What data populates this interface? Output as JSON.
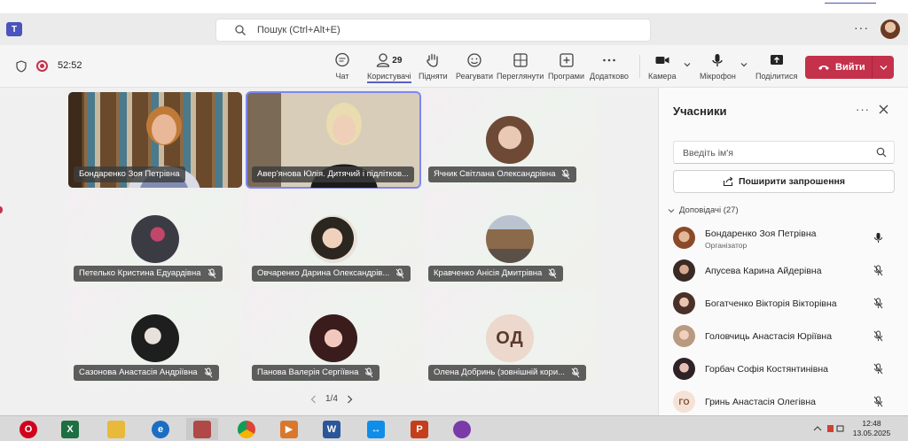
{
  "app": {
    "brand_color": "#4b53bc",
    "search_placeholder": "Пошук (Ctrl+Alt+E)",
    "more_label": "···"
  },
  "top_strip": {
    "text": ""
  },
  "meeting": {
    "timer": "52:52",
    "toolbar": {
      "chat": "Чат",
      "people": "Користувачі",
      "people_count": "29",
      "raise": "Підняти",
      "react": "Реагувати",
      "view": "Переглянути",
      "apps": "Програми",
      "more": "Додатково",
      "camera": "Камера",
      "mic": "Мікрофон",
      "share": "Поділитися",
      "leave": "Вийти"
    },
    "leave_color": "#c4314b"
  },
  "stage": {
    "tiles": [
      {
        "name": "Бондаренко Зоя Петрівна",
        "type": "video1",
        "muted": false
      },
      {
        "name": "Авер'янова Юлія. Дитячий і підлітков...",
        "type": "video2",
        "muted": false,
        "selected": true
      },
      {
        "name": "Ячник Світлана Олександрівна",
        "type": "avatar",
        "muted": true
      },
      {
        "name": "Петелько Кристина Едуардівна",
        "type": "avatar",
        "muted": true
      },
      {
        "name": "Овчаренко Дарина Олександрів...",
        "type": "avatar",
        "muted": true
      },
      {
        "name": "Кравченко Анісія Дмитрівна",
        "type": "avatar",
        "muted": true
      },
      {
        "name": "Сазонова Анастасія Андріївна",
        "type": "avatar",
        "muted": true
      },
      {
        "name": "Панова Валерія Сергіївна",
        "type": "avatar",
        "muted": true
      },
      {
        "name": "Олена Добринь (зовнішній кори...",
        "type": "initials",
        "initials": "ОД",
        "muted": true
      }
    ],
    "pager": "1/4"
  },
  "panel": {
    "title": "Учасники",
    "search_placeholder": "Введіть ім'я",
    "share_invite": "Поширити запрошення",
    "section": "Доповідачі (27)",
    "people": [
      {
        "name": "Бондаренко Зоя Петрівна",
        "role": "Організатор",
        "muted": false
      },
      {
        "name": "Апусева Карина Айдерівна",
        "muted": true
      },
      {
        "name": "Богатченко Вікторія Вікторівна",
        "muted": true
      },
      {
        "name": "Головчиць Анастасія Юріївна",
        "muted": true
      },
      {
        "name": "Горбач Софія Костянтинівна",
        "muted": true
      },
      {
        "name": "Гринь Анастасія Олегівна",
        "initials": "ГО",
        "muted": true
      }
    ]
  },
  "taskbar": {
    "time": "12:48",
    "date": "13.05.2025",
    "apps": [
      "opera-icon",
      "excel-icon",
      "file-explorer-icon",
      "edge-icon",
      "paint-icon",
      "chrome-icon",
      "media-player-icon",
      "word-icon",
      "teamviewer-icon",
      "powerpoint-icon",
      "vpn-icon"
    ]
  }
}
